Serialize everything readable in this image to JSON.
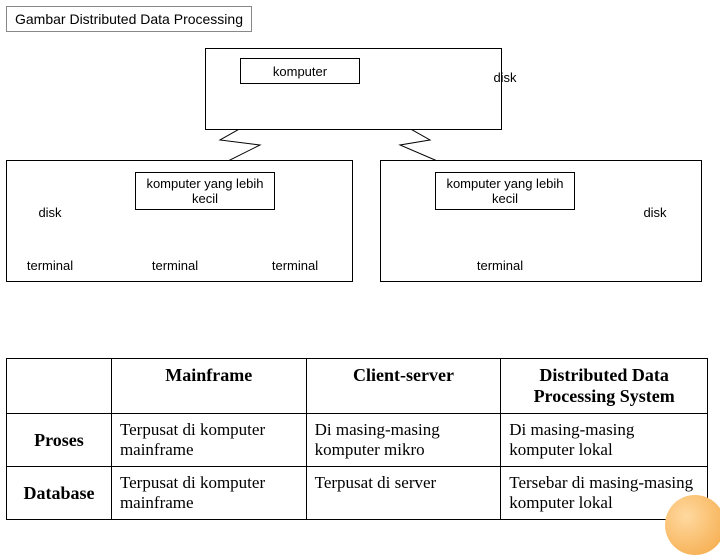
{
  "title": "Gambar Distributed Data Processing",
  "diagram": {
    "top_komputer": "komputer",
    "top_disk": "disk",
    "left_disk": "disk",
    "left_cpu": "komputer yang lebih kecil",
    "left_t1": "terminal",
    "left_t2": "terminal",
    "left_t3": "terminal",
    "right_cpu": "komputer yang lebih kecil",
    "right_disk": "disk",
    "right_t1": "terminal"
  },
  "table": {
    "header_c1": "Mainframe",
    "header_c2": "Client-server",
    "header_c3": "Distributed Data Processing System",
    "row1_head": "Proses",
    "row1_c1": "Terpusat di komputer mainframe",
    "row1_c2": "Di masing-masing komputer mikro",
    "row1_c3": "Di masing-masing komputer lokal",
    "row2_head": "Database",
    "row2_c1": "Terpusat di komputer mainframe",
    "row2_c2": "Terpusat di server",
    "row2_c3": "Tersebar di masing-masing komputer lokal"
  }
}
